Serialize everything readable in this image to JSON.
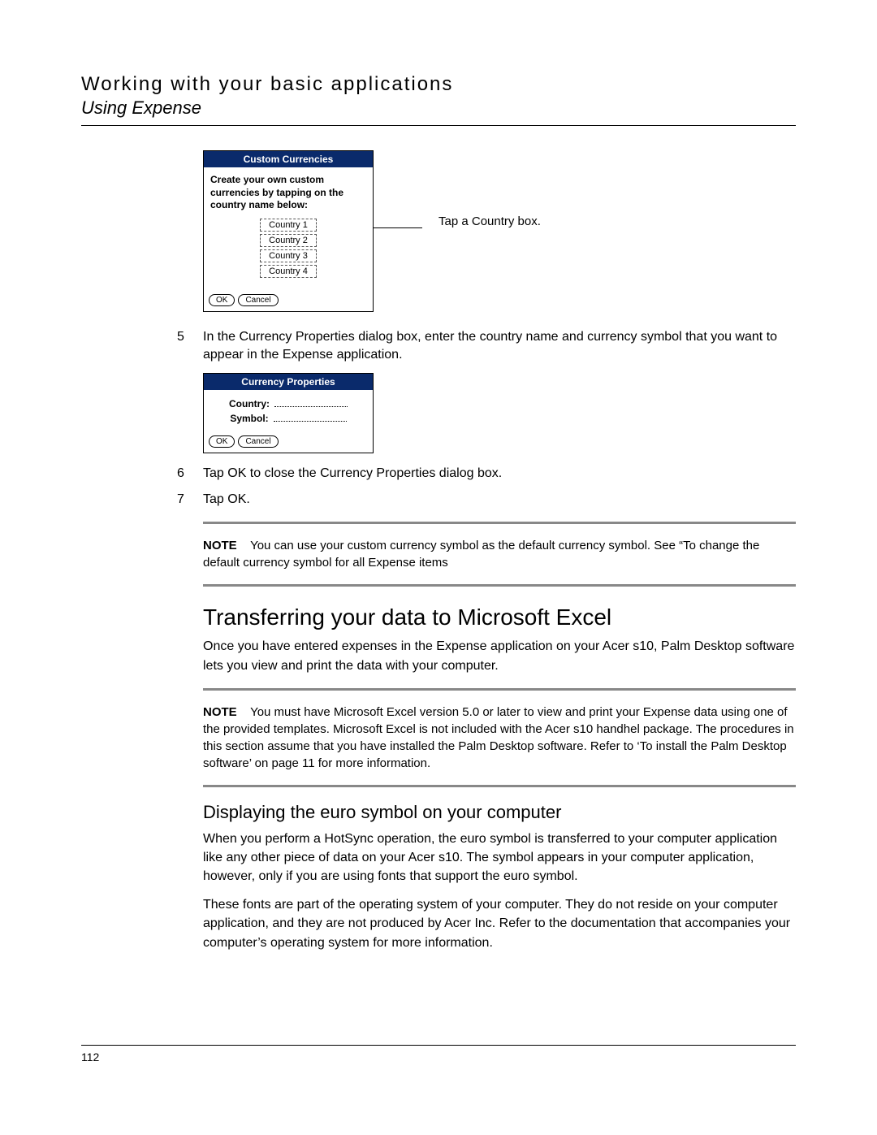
{
  "header": {
    "title": "Working with your basic applications",
    "subtitle": "Using Expense"
  },
  "fig1": {
    "title": "Custom Currencies",
    "instruction": "Create your own custom currencies by tapping on the country name below:",
    "countries": [
      "Country 1",
      "Country 2",
      "Country 3",
      "Country 4"
    ],
    "ok": "OK",
    "cancel": "Cancel",
    "callout": "Tap a Country box."
  },
  "step5": {
    "num": "5",
    "text": "In the Currency Properties dialog box, enter the country name and currency symbol that you want to appear in the Expense application."
  },
  "fig2": {
    "title": "Currency Properties",
    "country_label": "Country:",
    "symbol_label": "Symbol:",
    "ok": "OK",
    "cancel": "Cancel"
  },
  "step6": {
    "num": "6",
    "text": "Tap OK to close the Currency Properties dialog box."
  },
  "step7": {
    "num": "7",
    "text": "Tap OK."
  },
  "note1": {
    "label": "NOTE",
    "text": "You can use your custom currency symbol as the default currency symbol. See “To change the default currency symbol for all Expense items"
  },
  "section": {
    "h2": "Transferring your data to Microsoft Excel",
    "p1": "Once you have entered expenses in the Expense application on your Acer s10, Palm Desktop software lets you view and print the data with your computer."
  },
  "note2": {
    "label": "NOTE",
    "text": "You must have Microsoft Excel version 5.0 or later to view and print your Expense data using one of the provided templates. Microsoft Excel is not included with the Acer s10 handhel package. The procedures in this section assume that you have installed the Palm Desktop software. Refer to ‘To install the Palm Desktop software’ on page 11 for more information."
  },
  "euro": {
    "h3": "Displaying the euro symbol on your computer",
    "p1": "When you perform a HotSync operation, the euro symbol is transferred to your computer application like any other piece of data on your Acer s10. The symbol appears in your computer application, however, only if you are using fonts that support the euro symbol.",
    "p2": "These fonts are part of the operating system of your computer. They do not reside on your computer application, and they are not produced by Acer Inc. Refer to the documentation that accompanies your computer’s operating system for more information."
  },
  "page_number": "112"
}
